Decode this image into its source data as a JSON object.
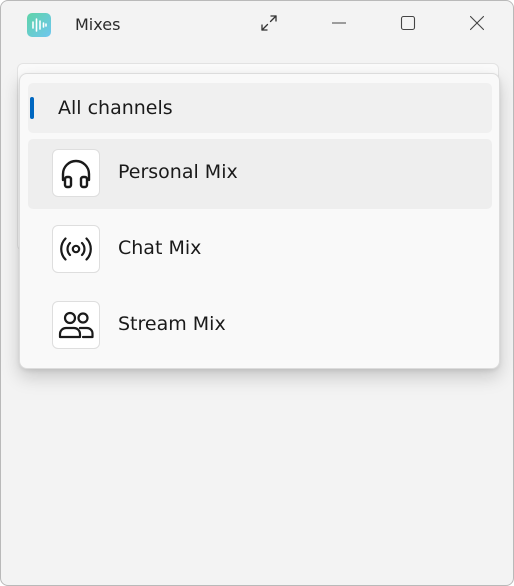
{
  "window": {
    "title": "Mixes",
    "app_icon": "waveform-icon"
  },
  "titlebar_buttons": [
    {
      "name": "expand",
      "icon": "expand-arrows-icon"
    },
    {
      "name": "minimize",
      "icon": "minimize-icon"
    },
    {
      "name": "maximize",
      "icon": "maximize-icon"
    },
    {
      "name": "close",
      "icon": "close-icon"
    }
  ],
  "menu": {
    "all_channels": {
      "label": "All channels",
      "selected": true
    },
    "items": [
      {
        "label": "Personal Mix",
        "icon": "headphones-icon",
        "hovered": true
      },
      {
        "label": "Chat Mix",
        "icon": "broadcast-icon",
        "hovered": false
      },
      {
        "label": "Stream Mix",
        "icon": "people-icon",
        "hovered": false
      }
    ]
  },
  "colors": {
    "accent": "#0067c0",
    "window_bg": "#f3f3f3",
    "flyout_bg": "#f9f9f9"
  }
}
